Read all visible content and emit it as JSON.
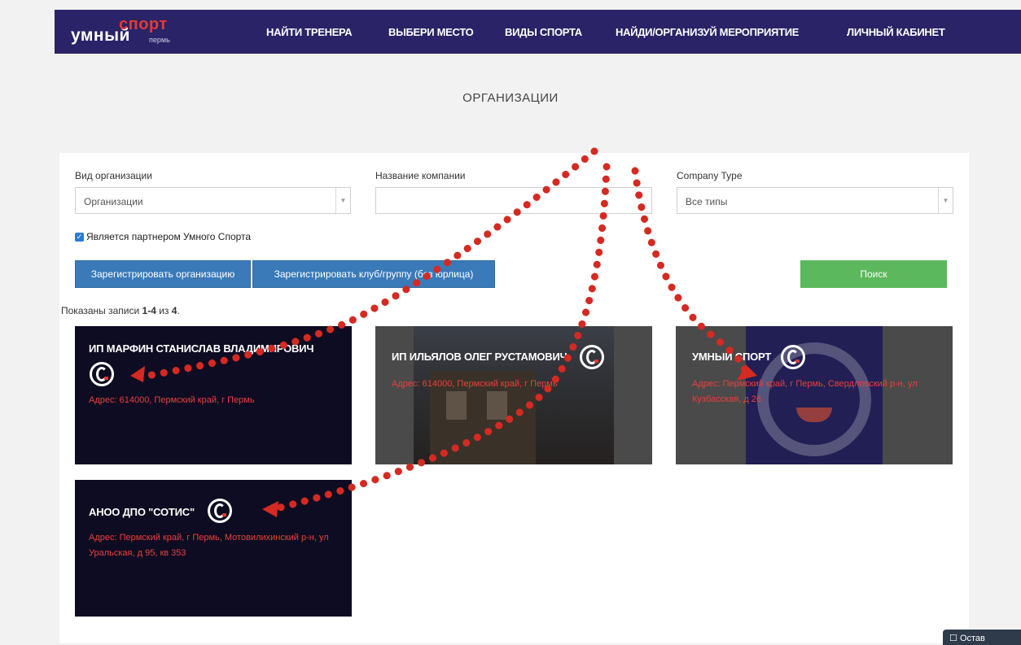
{
  "nav": {
    "logo": {
      "main": "умный",
      "sport": "спорт",
      "city": "пермь"
    },
    "items": [
      "НАЙТИ ТРЕНЕРА",
      "ВЫБЕРИ МЕСТО",
      "ВИДЫ СПОРТА",
      "НАЙДИ/ОРГАНИЗУЙ МЕРОПРИЯТИЕ",
      "ЛИЧНЫЙ КАБИНЕТ"
    ]
  },
  "page": {
    "title": "ОРГАНИЗАЦИИ"
  },
  "filters": {
    "org_type": {
      "label": "Вид организации",
      "value": "Организации"
    },
    "company_name": {
      "label": "Название компании",
      "value": ""
    },
    "company_type": {
      "label": "Company Type",
      "value": "Все типы"
    },
    "partner_checkbox": {
      "label": "Является партнером Умного Спорта",
      "checked": true
    }
  },
  "buttons": {
    "register_org": "Зарегистрировать организацию",
    "register_club": "Зарегистрировать клуб/группу (без юрлица)",
    "search": "Поиск"
  },
  "results": {
    "prefix": "Показаны записи ",
    "range": "1-4",
    "middle": " из ",
    "total": "4",
    "suffix": "."
  },
  "cards": [
    {
      "title": "ИП МАРФИН СТАНИСЛАВ ВЛАДИМИРОВИЧ",
      "address": "Адрес: 614000, Пермский край, г Пермь"
    },
    {
      "title": "ИП ИЛЬЯЛОВ ОЛЕГ РУСТАМОВИЧ",
      "address": "Адрес: 614000, Пермский край, г Пермь"
    },
    {
      "title": "УМНЫЙ СПОРТ",
      "address": "Адрес: Пермский край, г Пермь, Свердловский р-н, ул Кузбасская, д 26"
    },
    {
      "title": "АНОО ДПО \"СОТИС\"",
      "address": "Адрес: Пермский край, г Пермь, Мотовилихинский р-н, ул Уральская, д 95, кв 353"
    }
  ],
  "chat": {
    "label": "Остав"
  },
  "colors": {
    "nav_bg": "#2a2367",
    "accent_red": "#e23b35",
    "button_blue": "#3a7ab8",
    "button_green": "#5cb85c",
    "card_dark": "#0e0c22",
    "card_gray": "#4a4a4a"
  },
  "icons": [
    "checkbox-checked-icon",
    "dropdown-caret-icon",
    "company-logo-icon",
    "chat-icon"
  ]
}
